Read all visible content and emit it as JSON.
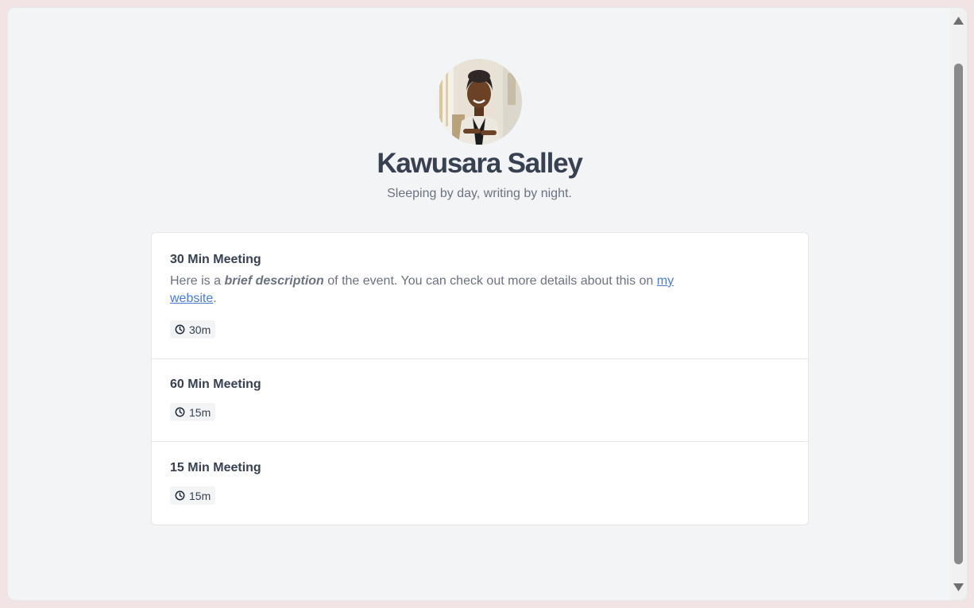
{
  "profile": {
    "name": "Kawusara Salley",
    "tagline": "Sleeping by day, writing by night.",
    "avatar_icon": "avatar-photo"
  },
  "events": [
    {
      "title": "30 Min Meeting",
      "description_before": "Here is a ",
      "description_emphasis": "brief description",
      "description_middle": " of the event. You can check out more details about this on ",
      "description_link": "my website",
      "description_after": ".",
      "duration": "30m"
    },
    {
      "title": "60 Min Meeting",
      "duration": "15m"
    },
    {
      "title": "15 Min Meeting",
      "duration": "15m"
    }
  ],
  "colors": {
    "page_bg": "#f2e4e4",
    "panel_bg": "#f3f4f6",
    "heading": "#374151",
    "muted": "#6b7280",
    "link": "#4b7bd3"
  },
  "icons": {
    "duration": "clock-icon"
  }
}
